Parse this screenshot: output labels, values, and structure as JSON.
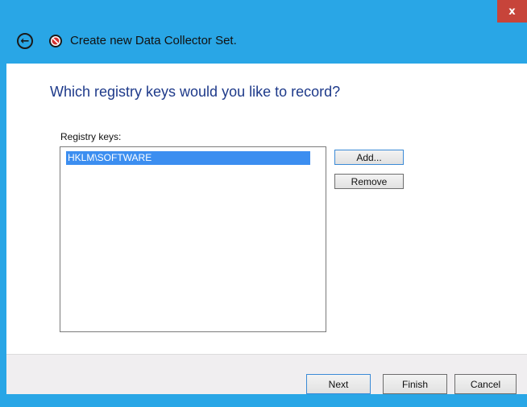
{
  "window": {
    "close_label": "x",
    "title": "Create new Data Collector Set."
  },
  "page": {
    "heading": "Which registry keys would you like to record?",
    "list_label": "Registry keys:",
    "registry_keys": [
      "HKLM\\SOFTWARE"
    ],
    "add_label": "Add...",
    "remove_label": "Remove"
  },
  "footer": {
    "next_label": "Next",
    "finish_label": "Finish",
    "cancel_label": "Cancel"
  },
  "icons": {
    "back": "back-arrow-icon",
    "app": "data-collector-icon",
    "close": "close-icon"
  },
  "colors": {
    "titlebar": "#29a6e6",
    "close": "#c7443a",
    "heading": "#1e3a8a",
    "selection": "#3c8ef0"
  }
}
